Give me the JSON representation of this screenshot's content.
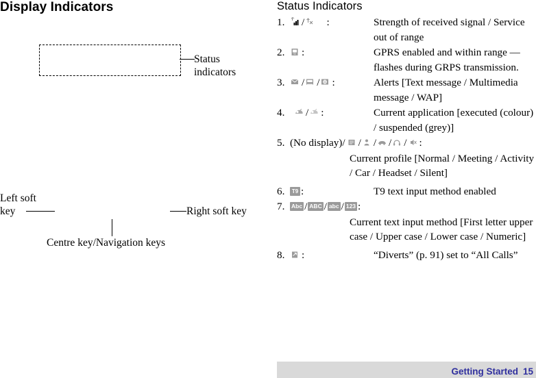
{
  "left": {
    "title": "Display Indicators",
    "status_label": "Status\nindicators",
    "status_label_line1": "Status",
    "status_label_line2": "indicators",
    "left_soft_line1": "Left soft",
    "left_soft_line2": "key",
    "right_soft_key": "Right soft key",
    "centre_key": "Centre key/Navigation keys"
  },
  "right": {
    "title": "Status Indicators",
    "items": [
      {
        "num": "1.",
        "icons": [
          "signal-strength-icon",
          "service-out-of-range-icon"
        ],
        "colon": ":",
        "desc": "Strength of received signal / Service out of range"
      },
      {
        "num": "2.",
        "icons": [
          "gprs-icon"
        ],
        "colon": ":",
        "desc": "GPRS enabled and within range — flashes during GRPS transmission."
      },
      {
        "num": "3.",
        "icons": [
          "text-message-icon",
          "multimedia-message-icon",
          "wap-icon"
        ],
        "colon": ":",
        "desc": "Alerts [Text message / Multimedia message / WAP]"
      },
      {
        "num": "4.",
        "icons": [
          "application-executed-colour-icon",
          "application-suspended-grey-icon"
        ],
        "colon": ":",
        "desc": "Current application [executed (colour) / suspended (grey)]"
      },
      {
        "num": "5.",
        "nodisplay": "(No display)/",
        "icons": [
          "profile-meeting-icon",
          "profile-activity-icon",
          "profile-car-icon",
          "profile-headset-icon",
          "profile-silent-icon"
        ],
        "colon": ":",
        "desc": "Current profile [Normal / Meeting / Activity / Car / Headset / Silent]",
        "desc_on_next_line": true
      },
      {
        "num": "6.",
        "icons": [
          "t9-text-input-icon"
        ],
        "colon": ":",
        "desc": "T9 text input method enabled"
      },
      {
        "num": "7.",
        "icons": [
          "abc-first-letter-upper-icon",
          "abc-upper-case-icon",
          "abc-lower-case-icon",
          "numeric-123-icon"
        ],
        "colon": ":",
        "desc": "Current text input method [First letter upper case / Upper case / Lower case / Numeric]",
        "desc_on_next_line": true
      },
      {
        "num": "8.",
        "icons": [
          "diverts-icon"
        ],
        "colon": ":",
        "desc": "“Diverts” (p. 91) set to “All Calls”"
      }
    ]
  },
  "footer": {
    "section": "Getting Started",
    "page": "15",
    "bar_color": "#d9d9d9",
    "text_color": "#2f2f9e"
  }
}
